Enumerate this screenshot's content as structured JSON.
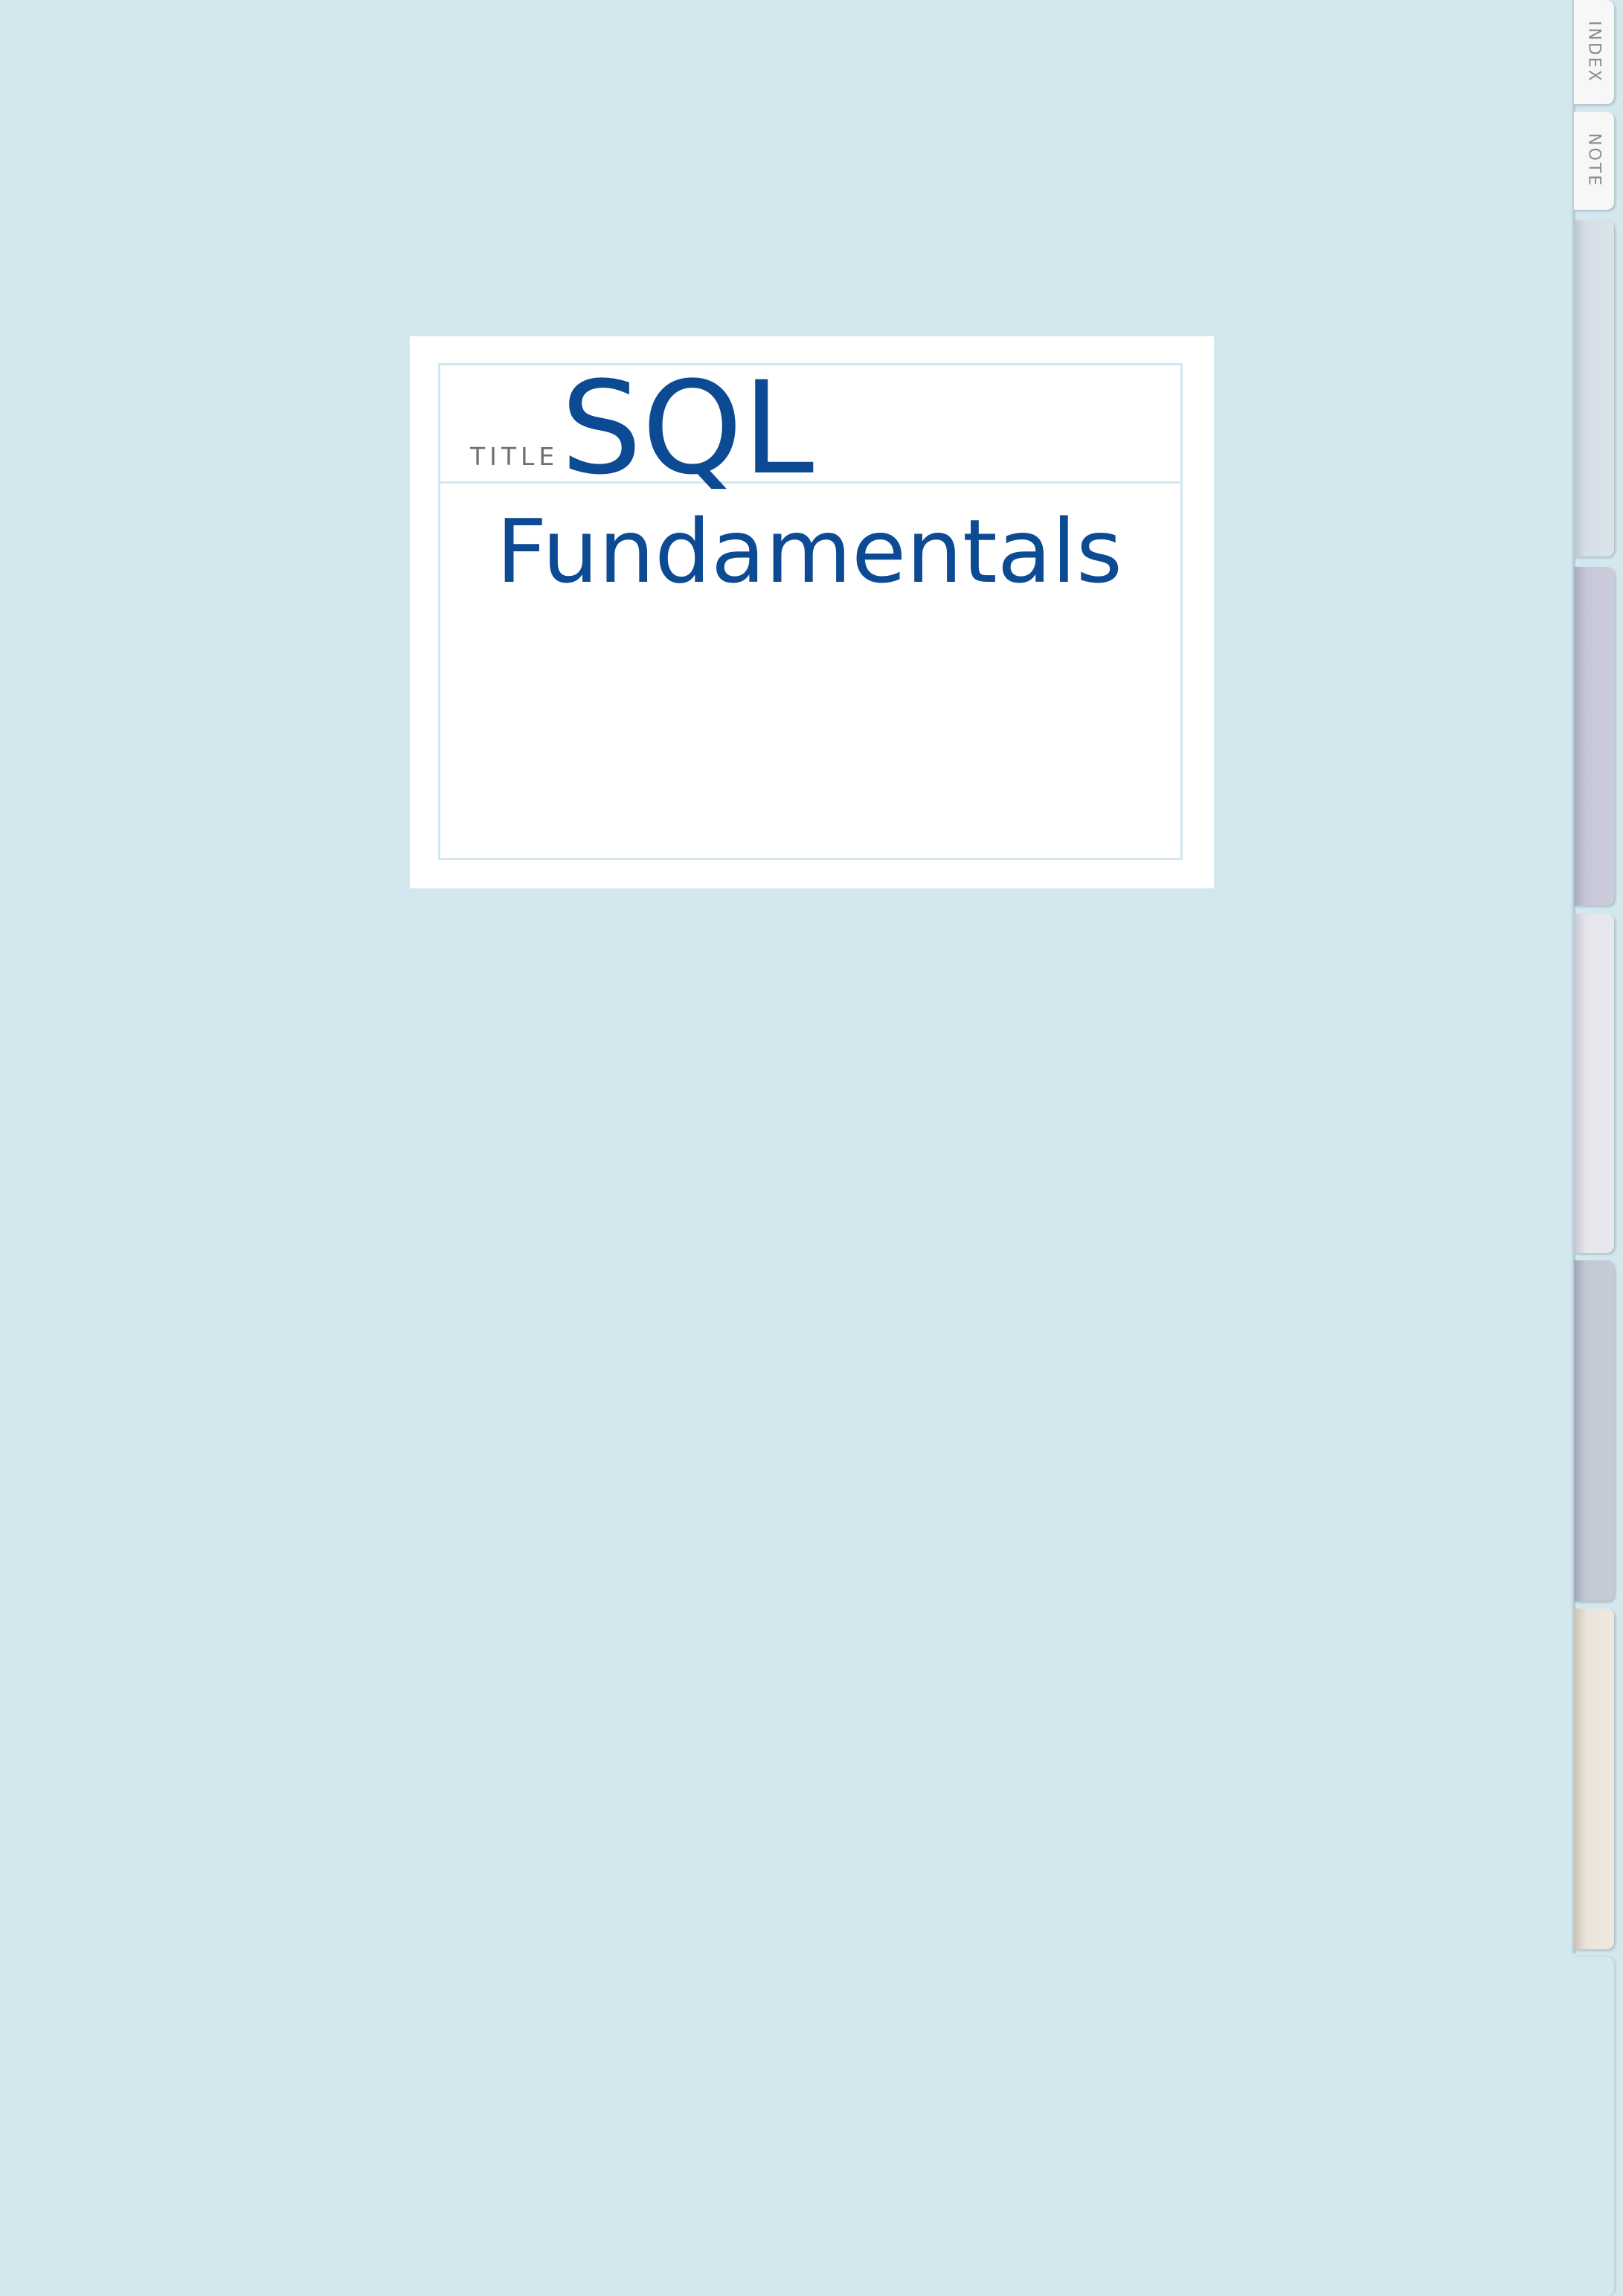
{
  "cover": {
    "background_color": "#d2e8ee",
    "title_label": "TITLE",
    "title_line_1": "SQL",
    "title_line_2": "Fundamentals",
    "ink_color": "#0d4a94"
  },
  "tabs": [
    {
      "label": "INDEX"
    },
    {
      "label": "NOTE"
    },
    {
      "label": "",
      "color": "#dbe3ea"
    },
    {
      "label": "",
      "color": "#ccccdc"
    },
    {
      "label": "",
      "color": "#e8e9ef"
    },
    {
      "label": "",
      "color": "#c6ccd6"
    },
    {
      "label": "",
      "color": "#efe9df"
    },
    {
      "label": "",
      "color": "#d2e8ee"
    }
  ]
}
